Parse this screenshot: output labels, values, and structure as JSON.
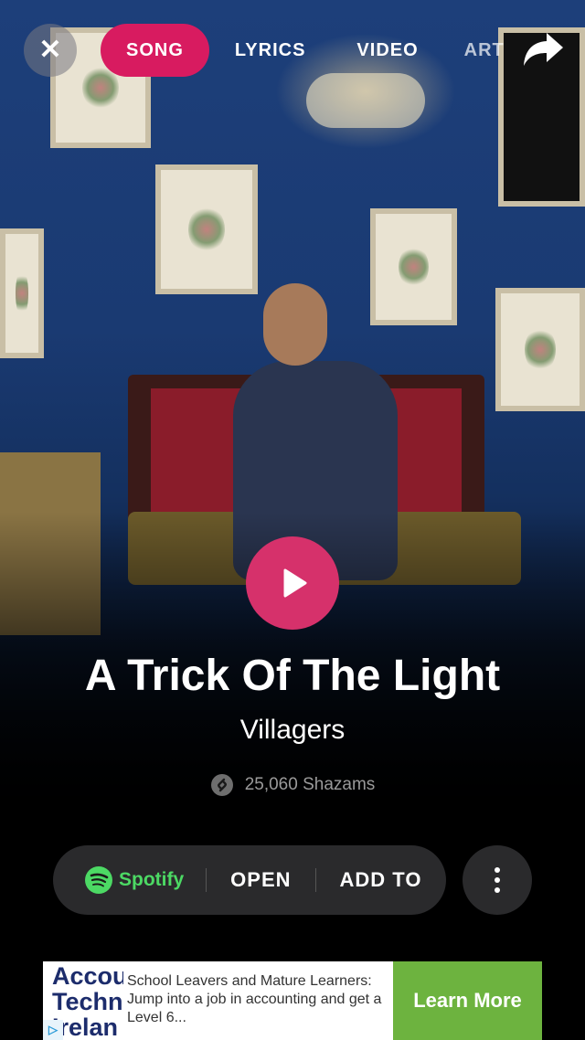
{
  "nav": {
    "tabs": [
      "SONG",
      "LYRICS",
      "VIDEO",
      "ART"
    ],
    "active_tab": "SONG"
  },
  "track": {
    "title": "A Trick Of The Light",
    "artist": "Villagers",
    "shazam_count": "25,060 Shazams"
  },
  "actions": {
    "provider": "Spotify",
    "open_label": "OPEN",
    "add_label": "ADD TO"
  },
  "ad": {
    "logo_lines": [
      "Accou",
      "Techn",
      "Irelan"
    ],
    "text": "School Leavers and Mature Learners: Jump into a job in accounting and get a Level 6...",
    "cta": "Learn More"
  },
  "colors": {
    "accent": "#d81b60",
    "spotify": "#4cd964",
    "cta": "#6db33f"
  }
}
